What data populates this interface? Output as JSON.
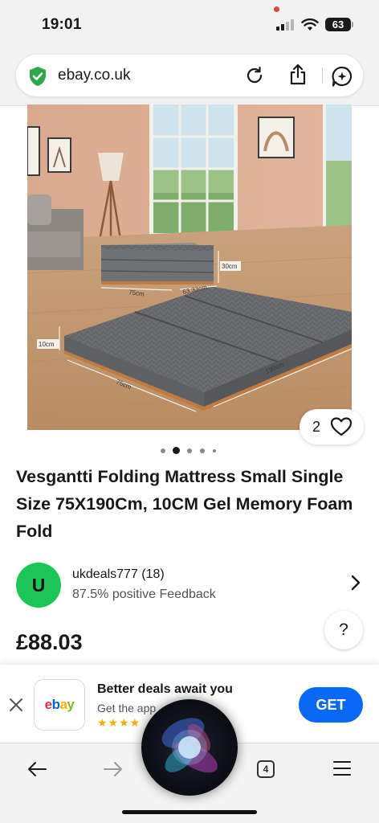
{
  "status_bar": {
    "time": "19:01",
    "battery": "63",
    "icons": [
      "signal-icon",
      "wifi-icon",
      "battery-icon"
    ]
  },
  "browser": {
    "url": "ebay.co.uk",
    "icons": [
      "shield-check-icon",
      "reload-icon",
      "share-icon",
      "ai-assistant-icon"
    ]
  },
  "product": {
    "watch_count": "2",
    "image_count": 5,
    "active_image": 1,
    "title": "Vesgantti Folding Mattress Small Single Size 75X190Cm, 10CM Gel Memory Foam Fold",
    "price": "£88.03",
    "image_labels": {
      "height_folded": "30cm",
      "width_folded": "75cm",
      "depth_folded": "63.33cm",
      "thickness": "10cm",
      "width": "75cm",
      "length": "190cm"
    }
  },
  "seller": {
    "initial": "U",
    "name": "ukdeals777 (18)",
    "feedback": "87.5% positive Feedback"
  },
  "help": {
    "label": "?"
  },
  "app_banner": {
    "logo_text": [
      "e",
      "b",
      "a",
      "y"
    ],
    "title": "Better deals await you",
    "subtitle": "Get the app",
    "stars": "★★★★",
    "get_label": "GET",
    "colors": {
      "e": "#e53238",
      "b": "#0064d2",
      "a": "#f5af02",
      "y": "#86b817",
      "get": "#0968f6"
    }
  },
  "toolbar": {
    "tab_count": "4",
    "icons": [
      "back-arrow-icon",
      "forward-arrow-icon",
      "tabs-icon",
      "menu-icon"
    ]
  }
}
